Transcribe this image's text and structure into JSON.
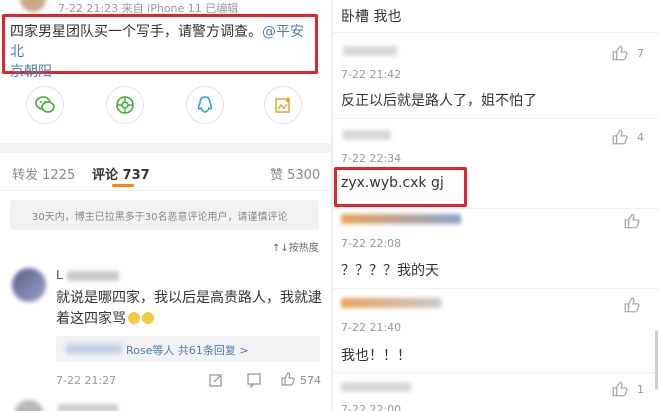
{
  "left": {
    "header_meta": "7-22 21:23  来自 iPhone 11  已编辑",
    "post_text_1": "四家男星团队买一个写手，请警方调查。",
    "post_mention_1": "@平安北",
    "post_mention_2": "京朝阳",
    "tabs": {
      "repost": "转发 1225",
      "comment": "评论 737",
      "like": "赞 5300"
    },
    "notice": "30天内，博主已拉黑多于30名恶意评论用户，请谨慎评论",
    "sort": "↑↓按热度",
    "comment": {
      "user": "L",
      "text_1": "就说是哪四家，我以后是高贵路人，我就逮",
      "text_2": "着这四家骂",
      "replies": "Rose等人  共61条回复 >",
      "time": "7-22 21:27",
      "likes": "574"
    }
  },
  "right": {
    "comments": [
      {
        "text": "卧槽 我也",
        "time": "",
        "likes": ""
      },
      {
        "text": "",
        "time": "7-22 21:42",
        "likes": "7"
      },
      {
        "text": "反正以后就是路人了，姐不怕了",
        "time": "7-22 22:34",
        "likes": "4"
      },
      {
        "text": "zyx.wyb.cxk gj",
        "time": "",
        "likes": ""
      },
      {
        "text": "？？？？我的天",
        "time": "7-22 22:08",
        "likes": ""
      },
      {
        "text": "我也！！！",
        "time": "7-22 21:40",
        "likes": ""
      },
      {
        "text": "",
        "time": "7-22 22:00",
        "likes": "1"
      }
    ]
  },
  "colors": {
    "accent_orange": "#ff8200",
    "link_blue": "#507daf",
    "highlight_red": "#e0242b"
  }
}
